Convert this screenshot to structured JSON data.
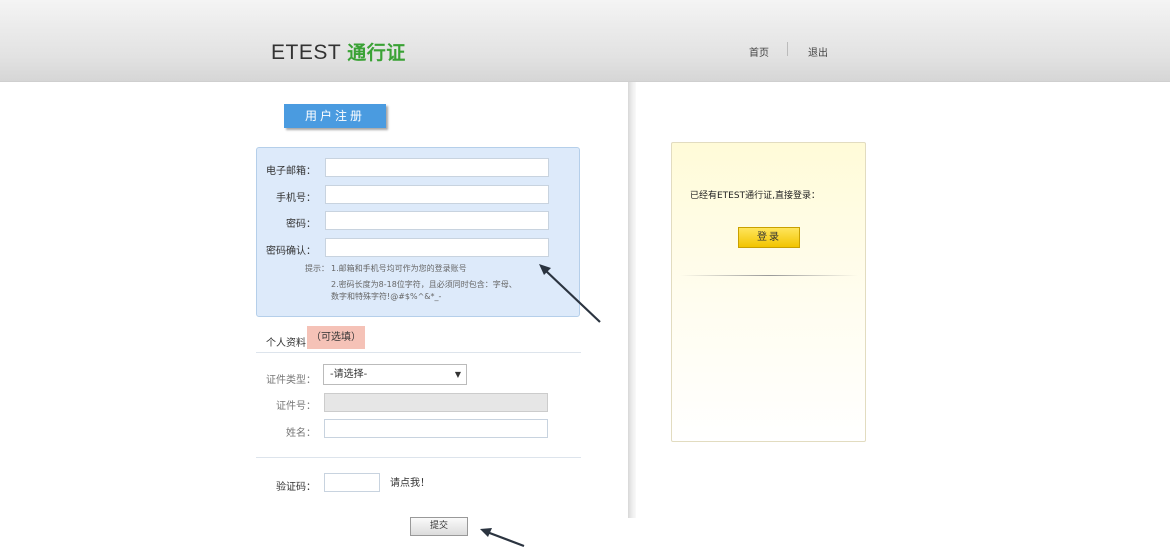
{
  "header": {
    "logo_main": "ETEST",
    "logo_accent": "通行证",
    "nav_home": "首页",
    "nav_logout": "退出"
  },
  "registration": {
    "tab_label": "用户注册",
    "email_label": "电子邮箱：",
    "phone_label": "手机号：",
    "password_label": "密码：",
    "confirm_label": "密码确认：",
    "hint_label": "提示：",
    "hint_1": "1.邮箱和手机号均可作为您的登录账号",
    "hint_2": "2.密码长度为8-18位字符，且必须同时包含：字母、",
    "hint_3": "数字和特殊字符!@#$%^&*_-"
  },
  "personal": {
    "title": "个人资料",
    "optional": "（可选填）",
    "id_type_label": "证件类型：",
    "id_type_value": "-请选择-",
    "id_number_label": "证件号：",
    "name_label": "姓名："
  },
  "captcha": {
    "label": "验证码：",
    "link": "请点我！"
  },
  "submit_label": "提交",
  "login": {
    "text": "已经有ETEST通行证,直接登录：",
    "button": "登录"
  },
  "colors": {
    "accent_green": "#3aa235",
    "tab_blue": "#4a9be0",
    "panel_blue": "#ddeafa",
    "login_yellow": "#f2c400",
    "optional_badge": "#f5c2b7"
  }
}
